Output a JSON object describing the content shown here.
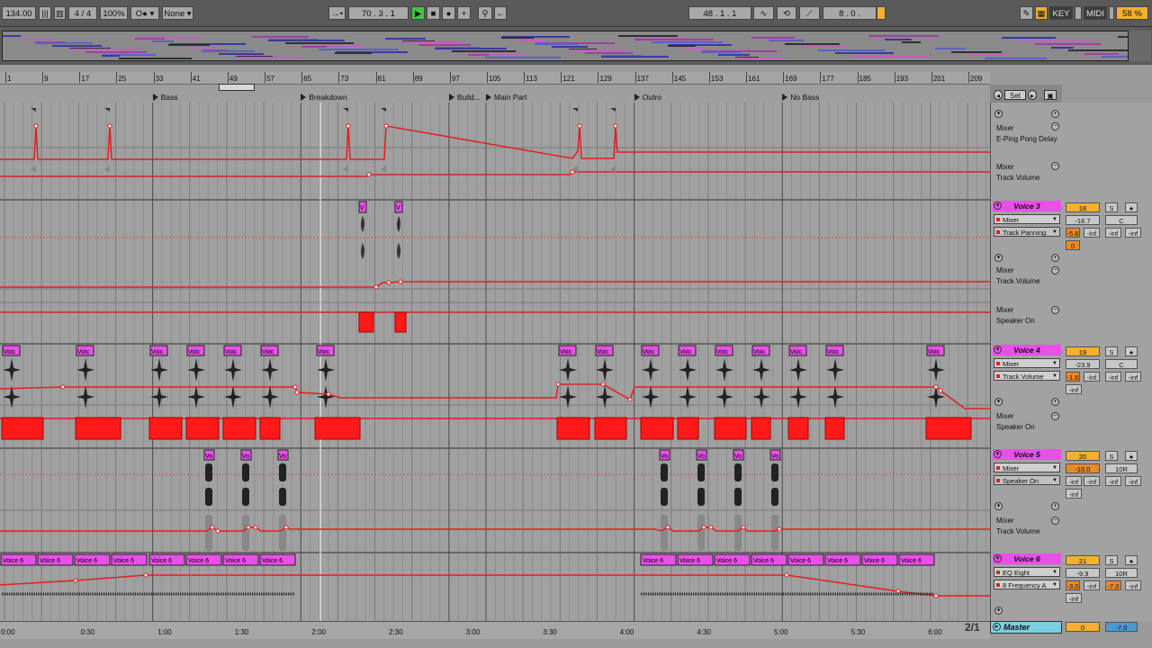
{
  "transport": {
    "tempo": "134.00",
    "time_signature": "4 / 4",
    "zoom": "100%",
    "quantize": "None",
    "position": "70 .  3 .  1",
    "loop_start": "48 .  1 .  1",
    "loop_length": "8 .  0 .",
    "key_label": "KEY",
    "midi_label": "MIDI",
    "cpu_load": "58 %"
  },
  "ruler": [
    "1",
    "9",
    "17",
    "25",
    "33",
    "41",
    "49",
    "57",
    "65",
    "73",
    "81",
    "89",
    "97",
    "105",
    "113",
    "121",
    "129",
    "137",
    "145",
    "153",
    "161",
    "169",
    "177",
    "185",
    "193",
    "201",
    "209"
  ],
  "locators": [
    {
      "label": "Bass"
    },
    {
      "label": "Breakdown"
    },
    {
      "label": "Build..."
    },
    {
      "label": "Main Part"
    },
    {
      "label": "Outro"
    },
    {
      "label": "No Bass"
    }
  ],
  "set_button": "Set",
  "tracks": {
    "top": {
      "auto1_device": "Mixer",
      "auto1_param": "E-Ping Pong Delay",
      "auto2_device": "Mixer",
      "auto2_param": "Track Volume"
    },
    "voice3": {
      "name": "Voice 3",
      "device": "Mixer",
      "param": "Track Panning",
      "lane1_device": "Mixer",
      "lane1_param": "Track Volume",
      "lane2_device": "Mixer",
      "lane2_param": "Speaker On",
      "clip_label": "V",
      "mixer": {
        "num": "18",
        "solo": "S",
        "vol": "-16.7",
        "pan": "C",
        "send": "-5.6",
        "m1": "-inf",
        "m2": "-inf",
        "m3": "-inf",
        "zero": "0"
      }
    },
    "voice4": {
      "name": "Voice 4",
      "device": "Mixer",
      "param": "Track Volume",
      "lane1_device": "Mixer",
      "lane1_param": "Speaker On",
      "clip_label": "Voic",
      "mixer": {
        "num": "19",
        "solo": "S",
        "vol": "-23.9",
        "pan": "C",
        "send": "-1.6",
        "m1": "-inf",
        "m2": "-inf",
        "m3": "-inf",
        "m4": "-inf"
      }
    },
    "voice5": {
      "name": "Voice 5",
      "device": "Mixer",
      "param": "Speaker On",
      "lane1_device": "Mixer",
      "lane1_param": "Track Volume",
      "clip_label": "Vo",
      "mixer": {
        "num": "20",
        "solo": "S",
        "vol": "-10.0",
        "pan": "10R",
        "m1": "-inf",
        "m2": "-inf",
        "m3": "-inf",
        "m4": "-inf",
        "m5": "-inf"
      }
    },
    "voice6": {
      "name": "Voice 6",
      "device": "EQ Eight",
      "param": "8 Frequency A",
      "clip_label": "Voice 6",
      "mixer": {
        "num": "21",
        "solo": "S",
        "vol": "-9.9",
        "pan": "10R",
        "send": "-3.0",
        "m1": "-inf",
        "m2": "-7.0",
        "m3": "-inf",
        "m4": "-inf"
      }
    },
    "master": {
      "name": "Master",
      "num": "0",
      "vol": "-7.0"
    }
  },
  "page_indicator": "2/1",
  "time_ruler": [
    "0:00",
    "0:30",
    "1:00",
    "1:30",
    "2:00",
    "2:30",
    "3:00",
    "3:30",
    "4:00",
    "4:30",
    "5:00",
    "5:30",
    "6:00"
  ],
  "colors": {
    "accent": "#e850e8",
    "automation": "#e02020",
    "clip": "#ff1a1a",
    "orange": "#f3b030",
    "master": "#7ad0e0"
  }
}
